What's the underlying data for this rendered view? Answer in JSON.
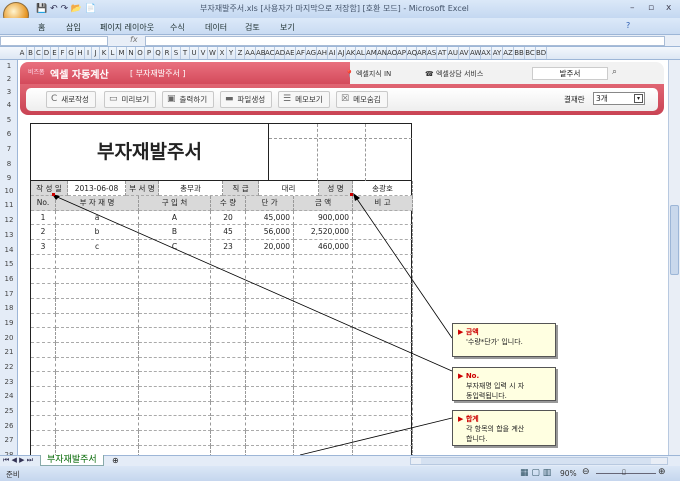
{
  "window": {
    "title": "부자재발주서.xls [사용자가 마지막으로 저장함] [호환 모드] - Microsoft Excel",
    "min": "–",
    "max": "▫",
    "close": "x"
  },
  "ribbon_tabs": [
    "홈",
    "삽입",
    "페이지 레이아웃",
    "수식",
    "데이터",
    "검토",
    "보기"
  ],
  "formula": {
    "fx": "fx",
    "name_box": "",
    "content": ""
  },
  "columns": [
    "A",
    "B",
    "C",
    "D",
    "E",
    "F",
    "G",
    "H",
    "I",
    "J",
    "K",
    "L",
    "M",
    "N",
    "O",
    "P",
    "Q",
    "R",
    "S",
    "T",
    "U",
    "V",
    "W",
    "X",
    "Y",
    "Z",
    "AA",
    "AB",
    "AC",
    "AD",
    "AE",
    "AF",
    "AG",
    "AH",
    "AI",
    "AJ",
    "AK",
    "AL",
    "AM",
    "AN",
    "AO",
    "AP",
    "AQ",
    "AR",
    "AS",
    "AT",
    "AU",
    "AV",
    "AW",
    "AX",
    "AY",
    "AZ",
    "BB",
    "BC",
    "BD"
  ],
  "rows": [
    "1",
    "2",
    "3",
    "4",
    "5",
    "6",
    "7",
    "8",
    "9",
    "10",
    "11",
    "12",
    "13",
    "14",
    "15",
    "16",
    "17",
    "18",
    "19",
    "20",
    "21",
    "22",
    "23",
    "24",
    "25",
    "26",
    "27",
    "28"
  ],
  "banner": {
    "brand": "비즈폼",
    "title": "엑셀 자동계산",
    "subtitle": "[ 부자재발주서 ]",
    "link1": "엑셀지식 IN",
    "link2": "엑셀상담 서비스",
    "search_value": "발주서",
    "buttons": [
      "새로작성",
      "미리보기",
      "출력하기",
      "파일생성",
      "메모보기",
      "메모숨김"
    ],
    "approval_label": "결재란",
    "approval_value": "3개"
  },
  "form": {
    "title": "부자재발주서",
    "info": {
      "date_label": "작 성 일",
      "date": "2013-06-08",
      "dept_label": "부 서 명",
      "dept": "총무과",
      "rank_label": "직  급",
      "rank": "대리",
      "name_label": "성  명",
      "name": "송광호"
    },
    "headers": [
      "No.",
      "부 자 재 명",
      "구  입  처",
      "수 량",
      "단  가",
      "금  액",
      "비  고"
    ],
    "items": [
      [
        "1",
        "a",
        "A",
        "20",
        "45,000",
        "900,000",
        ""
      ],
      [
        "2",
        "b",
        "B",
        "45",
        "56,000",
        "2,520,000",
        ""
      ],
      [
        "3",
        "c",
        "C",
        "23",
        "20,000",
        "460,000",
        ""
      ]
    ]
  },
  "comments": [
    {
      "title": "금액",
      "text": "'수량*단가' 입니다."
    },
    {
      "title": "No.",
      "text": "부자재명 입력 시 자동입력됩니다."
    },
    {
      "title": "합계",
      "text": "각 항목의 합을 계산합니다."
    }
  ],
  "sheet_tab": "부자재발주서",
  "status": {
    "ready": "준비",
    "zoom": "90%"
  }
}
